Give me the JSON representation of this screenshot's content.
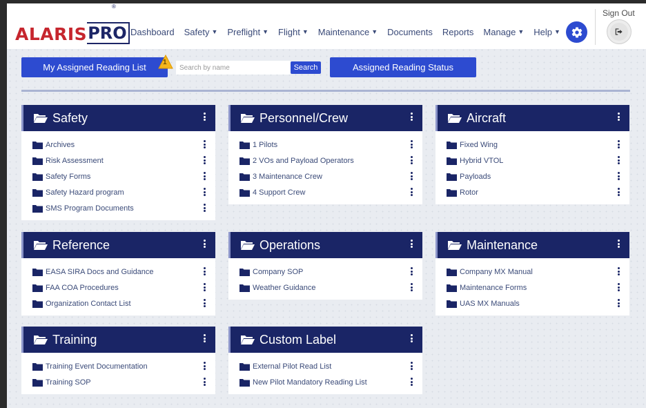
{
  "logo": {
    "part1": "ALARIS",
    "part2": "PRO",
    "reg": "®"
  },
  "nav": [
    {
      "label": "Dashboard",
      "caret": false
    },
    {
      "label": "Safety",
      "caret": true
    },
    {
      "label": "Preflight",
      "caret": true
    },
    {
      "label": "Flight",
      "caret": true
    },
    {
      "label": "Maintenance",
      "caret": true
    },
    {
      "label": "Documents",
      "caret": false
    },
    {
      "label": "Reports",
      "caret": false
    },
    {
      "label": "Manage",
      "caret": true
    },
    {
      "label": "Help",
      "caret": true
    }
  ],
  "user": {
    "signout_label": "Sign Out"
  },
  "toolbar": {
    "reading_list_label": "My Assigned Reading List",
    "reading_list_badge": "1",
    "search_placeholder": "Search by name",
    "search_button": "Search",
    "reading_status_label": "Assigned Reading Status"
  },
  "colors": {
    "primary": "#2d4bd0",
    "header_navy": "#1a2566",
    "logo_red": "#c6262e",
    "badge": "#f5b51d"
  },
  "icons": {
    "folder": "folder-open-icon",
    "item": "folder-icon",
    "menu": "kebab-icon",
    "gear": "gear-icon",
    "signout": "signout-icon"
  },
  "categories": [
    {
      "title": "Safety",
      "items": [
        "Archives",
        "Risk Assessment",
        "Safety Forms",
        "Safety Hazard program",
        "SMS Program Documents"
      ]
    },
    {
      "title": "Personnel/Crew",
      "items": [
        "1 Pilots",
        "2 VOs and Payload Operators",
        "3 Maintenance Crew",
        "4 Support Crew"
      ]
    },
    {
      "title": "Aircraft",
      "items": [
        "Fixed Wing",
        "Hybrid VTOL",
        "Payloads",
        "Rotor"
      ]
    },
    {
      "title": "Reference",
      "items": [
        "EASA SIRA Docs and Guidance",
        "FAA COA Procedures",
        "Organization Contact List"
      ]
    },
    {
      "title": "Operations",
      "items": [
        "Company SOP",
        "Weather Guidance"
      ]
    },
    {
      "title": "Maintenance",
      "items": [
        "Company MX Manual",
        "Maintenance Forms",
        "UAS MX Manuals"
      ]
    },
    {
      "title": "Training",
      "items": [
        "Training Event Documentation",
        "Training SOP"
      ]
    },
    {
      "title": "Custom Label",
      "items": [
        "External Pilot Read List",
        "New Pilot Mandatory Reading List"
      ]
    }
  ]
}
